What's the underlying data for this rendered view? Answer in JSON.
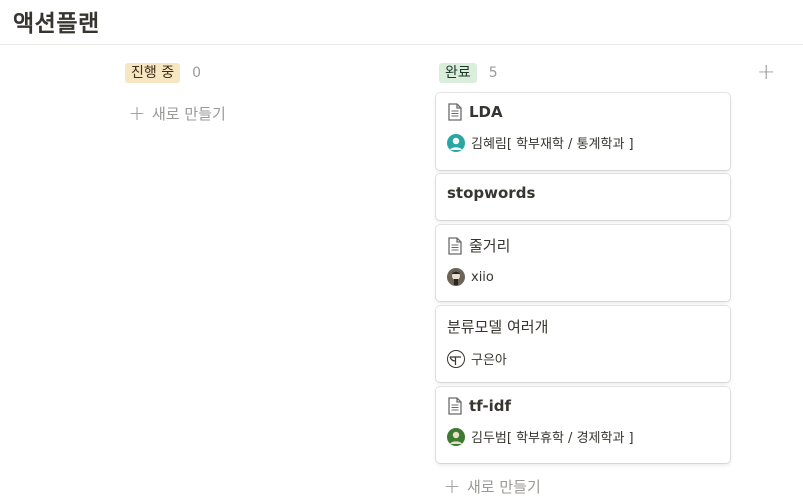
{
  "page": {
    "title": "액션플랜"
  },
  "columns": [
    {
      "status": "진행 중",
      "count": "0",
      "new_label": "새로 만들기"
    },
    {
      "status": "완료",
      "count": "5",
      "new_label": "새로 만들기"
    }
  ],
  "cards": [
    {
      "title": "LDA",
      "person": "김혜림[ 학부재학 / 통계학과 ]",
      "icon": "document-icon"
    },
    {
      "title": "stopwords"
    },
    {
      "title": "줄거리",
      "person": "xiio",
      "icon": "document-icon"
    },
    {
      "title": "분류모델 여러개",
      "person": "구은아"
    },
    {
      "title": "tf-idf",
      "person": "김두범[ 학부휴학 / 경제학과 ]",
      "icon": "document-icon"
    }
  ],
  "add_group_label": "+",
  "colors": {
    "in_progress_tag": "#f6e6c2",
    "done_tag": "#dbeddb",
    "muted": "#9b9a97"
  }
}
